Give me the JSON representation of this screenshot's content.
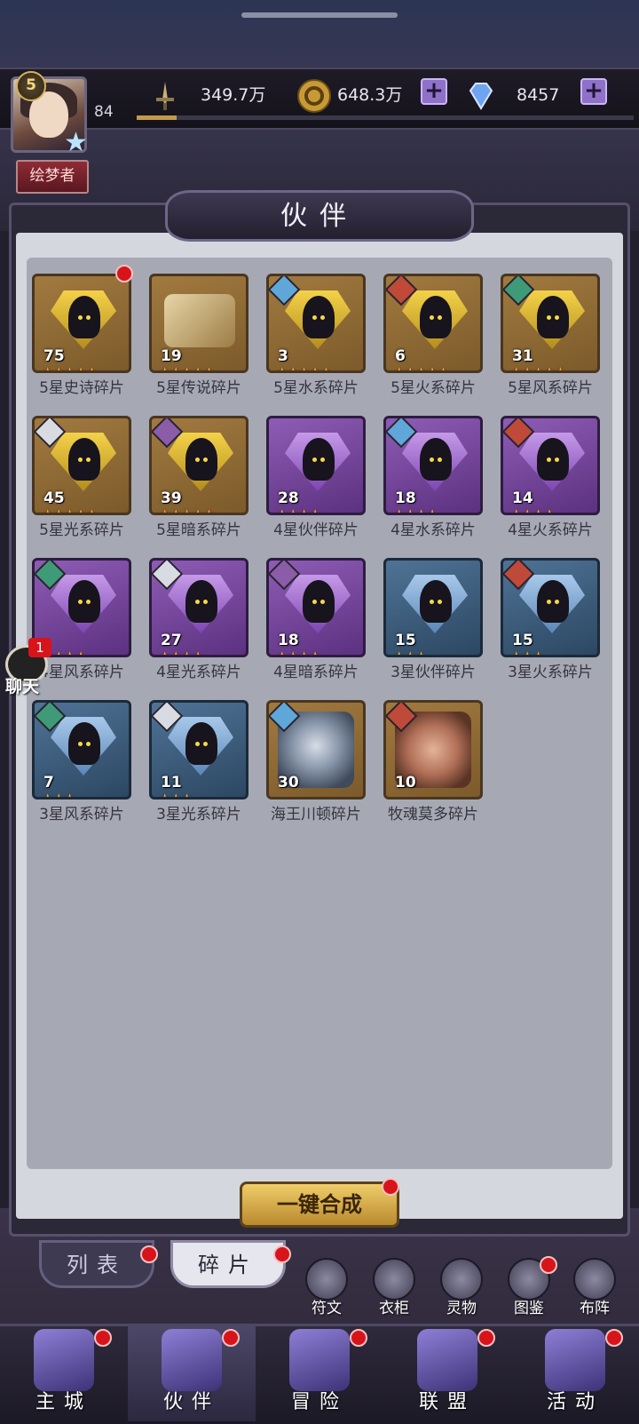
{
  "player": {
    "vip_level": "5",
    "level": "84",
    "xp_fraction": 0.08,
    "title": "绘梦者"
  },
  "resources": {
    "power": "349.7万",
    "gold": "648.3万",
    "diamonds": "8457"
  },
  "panel": {
    "title": "伙伴"
  },
  "fragments": [
    {
      "label": "5星史诗碎片",
      "count": "75",
      "stars": 5,
      "rarity": "gold",
      "element": "",
      "art": "hood",
      "badge": true
    },
    {
      "label": "5星传说碎片",
      "count": "19",
      "stars": 5,
      "rarity": "gold",
      "element": "",
      "art": "scroll",
      "badge": false
    },
    {
      "label": "5星水系碎片",
      "count": "3",
      "stars": 5,
      "rarity": "gold",
      "element": "water",
      "art": "hood",
      "badge": false
    },
    {
      "label": "5星火系碎片",
      "count": "6",
      "stars": 5,
      "rarity": "gold",
      "element": "fire",
      "art": "hood",
      "badge": false
    },
    {
      "label": "5星风系碎片",
      "count": "31",
      "stars": 5,
      "rarity": "gold",
      "element": "wind",
      "art": "hood",
      "badge": false
    },
    {
      "label": "5星光系碎片",
      "count": "45",
      "stars": 5,
      "rarity": "gold",
      "element": "light",
      "art": "hood",
      "badge": false
    },
    {
      "label": "5星暗系碎片",
      "count": "39",
      "stars": 5,
      "rarity": "gold",
      "element": "dark",
      "art": "hood",
      "badge": false
    },
    {
      "label": "4星伙伴碎片",
      "count": "28",
      "stars": 4,
      "rarity": "purple",
      "element": "",
      "art": "hood",
      "badge": false
    },
    {
      "label": "4星水系碎片",
      "count": "18",
      "stars": 4,
      "rarity": "purple",
      "element": "water",
      "art": "hood",
      "badge": false
    },
    {
      "label": "4星火系碎片",
      "count": "14",
      "stars": 4,
      "rarity": "purple",
      "element": "fire",
      "art": "hood",
      "badge": false
    },
    {
      "label": "4星风系碎片",
      "count": "",
      "stars": 4,
      "rarity": "purple",
      "element": "wind",
      "art": "hood",
      "badge": false
    },
    {
      "label": "4星光系碎片",
      "count": "27",
      "stars": 4,
      "rarity": "purple",
      "element": "light",
      "art": "hood",
      "badge": false
    },
    {
      "label": "4星暗系碎片",
      "count": "18",
      "stars": 4,
      "rarity": "purple",
      "element": "dark",
      "art": "hood",
      "badge": false
    },
    {
      "label": "3星伙伴碎片",
      "count": "15",
      "stars": 3,
      "rarity": "blue",
      "element": "",
      "art": "hood",
      "badge": false
    },
    {
      "label": "3星火系碎片",
      "count": "15",
      "stars": 3,
      "rarity": "blue",
      "element": "fire",
      "art": "hood",
      "badge": false
    },
    {
      "label": "3星风系碎片",
      "count": "7",
      "stars": 3,
      "rarity": "blue",
      "element": "wind",
      "art": "hood",
      "badge": false
    },
    {
      "label": "3星光系碎片",
      "count": "11",
      "stars": 3,
      "rarity": "blue",
      "element": "light",
      "art": "hood",
      "badge": false
    },
    {
      "label": "海王川顿碎片",
      "count": "30",
      "stars": 0,
      "rarity": "gold",
      "element": "water",
      "art": "king",
      "badge": false
    },
    {
      "label": "牧魂莫多碎片",
      "count": "10",
      "stars": 0,
      "rarity": "gold",
      "element": "fire",
      "art": "man",
      "badge": false
    }
  ],
  "actions": {
    "synthesize": "一键合成"
  },
  "chat": {
    "label": "聊天",
    "unread": "1"
  },
  "subtabs": [
    {
      "label": "列表"
    },
    {
      "label": "碎片"
    }
  ],
  "tools": [
    {
      "label": "符文",
      "icon": "rune-icon"
    },
    {
      "label": "衣柜",
      "icon": "wardrobe-icon"
    },
    {
      "label": "灵物",
      "icon": "spirit-icon"
    },
    {
      "label": "图鉴",
      "icon": "codex-icon"
    },
    {
      "label": "布阵",
      "icon": "formation-icon"
    }
  ],
  "nav": [
    {
      "label": "主城",
      "icon": "castle-icon"
    },
    {
      "label": "伙伴",
      "icon": "partner-icon"
    },
    {
      "label": "冒险",
      "icon": "adventure-icon"
    },
    {
      "label": "联盟",
      "icon": "alliance-icon"
    },
    {
      "label": "活动",
      "icon": "event-cards-icon"
    }
  ],
  "colors": {
    "notification": "#d8141b",
    "star": "#f0a235",
    "button_gold": "#f0cd69"
  }
}
